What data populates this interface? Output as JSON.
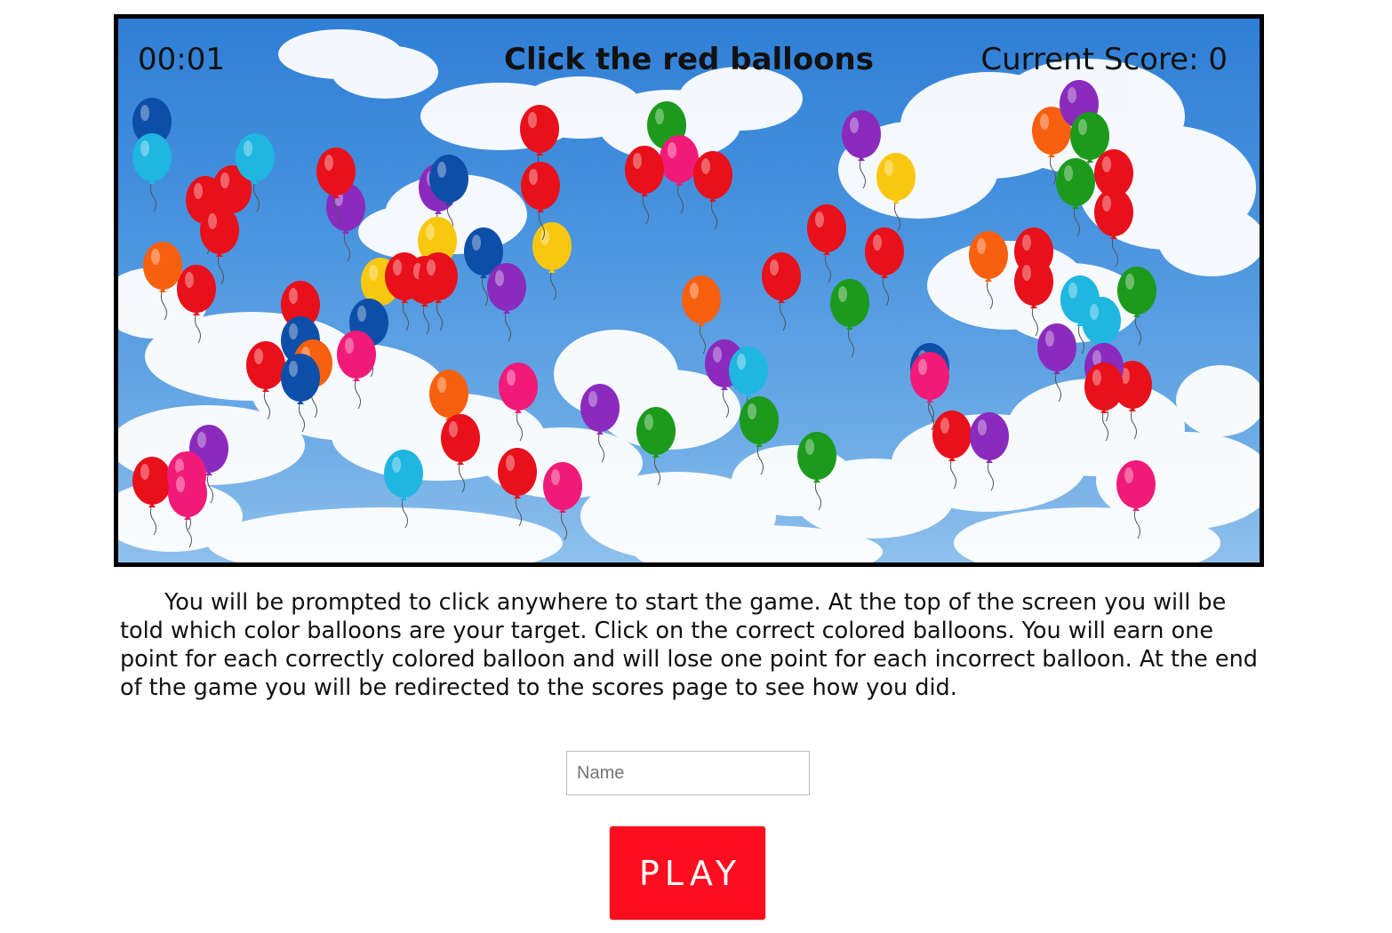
{
  "game": {
    "timer": "00:01",
    "prompt": "Click the red balloons",
    "score_text": "Current Score: 0",
    "target_color": "red",
    "balloon_colors": {
      "red": "#e8101a",
      "blue": "#0d4fa8",
      "cyan": "#1fb6e0",
      "green": "#1c9a1c",
      "purple": "#8a2bbd",
      "pink": "#f01b78",
      "orange": "#f7600f",
      "yellow": "#f7c80f"
    },
    "balloons": [
      "blue",
      "cyan",
      "red",
      "red",
      "cyan",
      "red",
      "red",
      "purple",
      "purple",
      "blue",
      "red",
      "red",
      "green",
      "pink",
      "red",
      "red",
      "purple",
      "yellow",
      "orange",
      "purple",
      "green",
      "green",
      "red",
      "red",
      "orange",
      "red",
      "yellow",
      "yellow",
      "blue",
      "purple",
      "red",
      "yellow",
      "red",
      "red",
      "red",
      "orange",
      "red",
      "red",
      "green",
      "orange",
      "red",
      "red",
      "cyan",
      "cyan",
      "green",
      "red",
      "blue",
      "blue",
      "pink",
      "red",
      "orange",
      "blue",
      "red",
      "purple",
      "cyan",
      "purple",
      "blue",
      "pink",
      "purple",
      "red",
      "orange",
      "red",
      "pink",
      "purple",
      "green",
      "green",
      "green",
      "red",
      "purple",
      "cyan",
      "purple",
      "red",
      "pink",
      "pink",
      "red",
      "pink",
      "pink"
    ]
  },
  "instructions": "You will be prompted to click anywhere to start the game. At the top of the screen you will be told which color balloons are your target. Click on the correct colored balloons. You will earn one point for each correctly colored balloon and will lose one point for each incorrect balloon. At the end of the game you will be redirected to the scores page to see how you did.",
  "form": {
    "name_placeholder": "Name",
    "name_value": "",
    "play_label": "PLAY"
  }
}
